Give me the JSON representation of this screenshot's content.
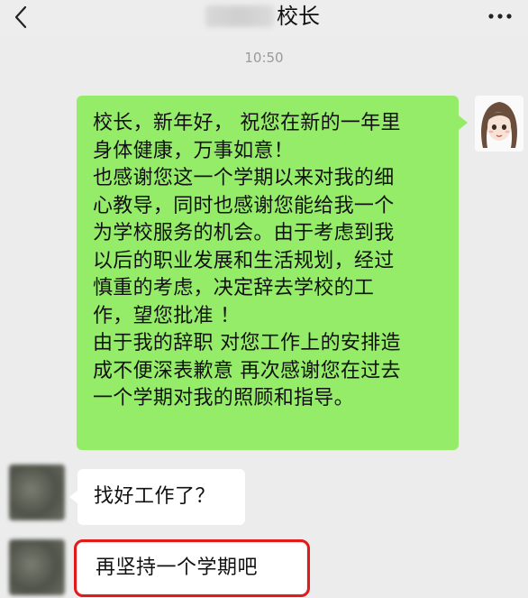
{
  "header": {
    "title": "校长",
    "back_icon": "chevron-left-icon",
    "more_icon": "more-horizontal-icon"
  },
  "timestamp": "10:50",
  "messages": [
    {
      "side": "right",
      "text": "校长，新年好， 祝您在新的一年里\n身体健康，万事如意！\n也感谢您这一个学期以来对我的细\n心教导，同时也感谢您能给我一个\n为学校服务的机会。由于考虑到我\n以后的职业发展和生活规划，经过\n慎重的考虑，决定辞去学校的工\n作，望您批准 ！\n由于我的辞职 对您工作上的安排造\n成不便深表歉意 再次感谢您在过去\n一个学期对我的照顾和指导。"
    },
    {
      "side": "left",
      "text": "找好工作了？"
    },
    {
      "side": "left",
      "text": "再坚持一个学期吧",
      "highlighted": true
    }
  ],
  "colors": {
    "background": "#ececec",
    "bubble_sent": "#95ec69",
    "bubble_received": "#ffffff",
    "highlight_border": "#e11a1a"
  }
}
